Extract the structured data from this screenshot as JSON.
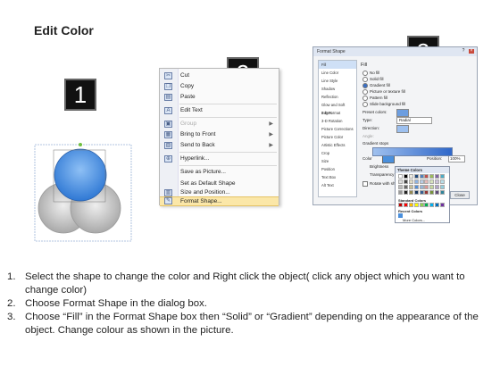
{
  "title": "Edit Color",
  "badges": [
    "1",
    "2",
    "3"
  ],
  "menu": {
    "items": [
      {
        "label": "Cut",
        "icon": "cut-icon",
        "glyph": "✂",
        "disabled": false,
        "submenu": false
      },
      {
        "label": "Copy",
        "icon": "copy-icon",
        "glyph": "❐",
        "disabled": false,
        "submenu": false
      },
      {
        "label": "Paste",
        "icon": "paste-icon",
        "glyph": "▤",
        "disabled": false,
        "submenu": false
      },
      {
        "label": "Edit Text",
        "icon": "edit-text-icon",
        "glyph": "A",
        "disabled": false,
        "submenu": false
      },
      {
        "label": "Group",
        "icon": "group-icon",
        "glyph": "▣",
        "disabled": true,
        "submenu": true
      },
      {
        "label": "Bring to Front",
        "icon": "bring-front-icon",
        "glyph": "▦",
        "disabled": false,
        "submenu": true
      },
      {
        "label": "Send to Back",
        "icon": "send-back-icon",
        "glyph": "▧",
        "disabled": false,
        "submenu": true
      },
      {
        "label": "Hyperlink...",
        "icon": "hyperlink-icon",
        "glyph": "⊕",
        "disabled": false,
        "submenu": false
      },
      {
        "label": "Save as Picture...",
        "icon": "",
        "glyph": "",
        "disabled": false,
        "submenu": false
      },
      {
        "label": "Set as Default Shape",
        "icon": "",
        "glyph": "",
        "disabled": false,
        "submenu": false
      },
      {
        "label": "Size and Position...",
        "icon": "size-position-icon",
        "glyph": "▥",
        "disabled": false,
        "submenu": false
      },
      {
        "label": "Format Shape...",
        "icon": "format-shape-icon",
        "glyph": "✎",
        "disabled": false,
        "submenu": false
      }
    ]
  },
  "dialog": {
    "title": "Format Shape",
    "sidebar": [
      "Fill",
      "Line Color",
      "Line Style",
      "Shadow",
      "Reflection",
      "Glow and Soft Edges",
      "3-D Format",
      "3-D Rotation",
      "Picture Corrections",
      "Picture Color",
      "Artistic Effects",
      "Crop",
      "Size",
      "Position",
      "Text Box",
      "Alt Text"
    ],
    "section": "Fill",
    "options": [
      "No fill",
      "Solid fill",
      "Gradient fill",
      "Picture or texture fill",
      "Pattern fill",
      "Slide background fill"
    ],
    "fields": [
      "Preset colors:",
      "Type:",
      "Direction:",
      "Angle:",
      "Gradient stops"
    ],
    "type_value": "Radial",
    "color_label": "Color",
    "position_label": "Position:",
    "position_value": "100%",
    "brightness_label": "Brightness",
    "transparency_label": "Transparency",
    "rotate_label": "Rotate with shape",
    "close_label": "Close",
    "popup": {
      "theme": "Theme Colors",
      "standard": "Standard Colors",
      "recent": "Recent Colors",
      "more": "More Colors..."
    }
  },
  "steps": [
    {
      "num": "1.",
      "text": "Select the shape to change the color and Right click the object( click any object which you want to change color)"
    },
    {
      "num": "2.",
      "text": "Choose Format Shape in the dialog box."
    },
    {
      "num": "3.",
      "text": "Choose “Fill” in the Format Shape box then “Solid” or “Gradient” depending on the appearance of the object. Change colour as shown in the picture."
    }
  ],
  "colors": {
    "blue_circle": "#4a8fdc",
    "gray_circle": "#b9b9b9",
    "highlight": "#fbe7a8"
  }
}
